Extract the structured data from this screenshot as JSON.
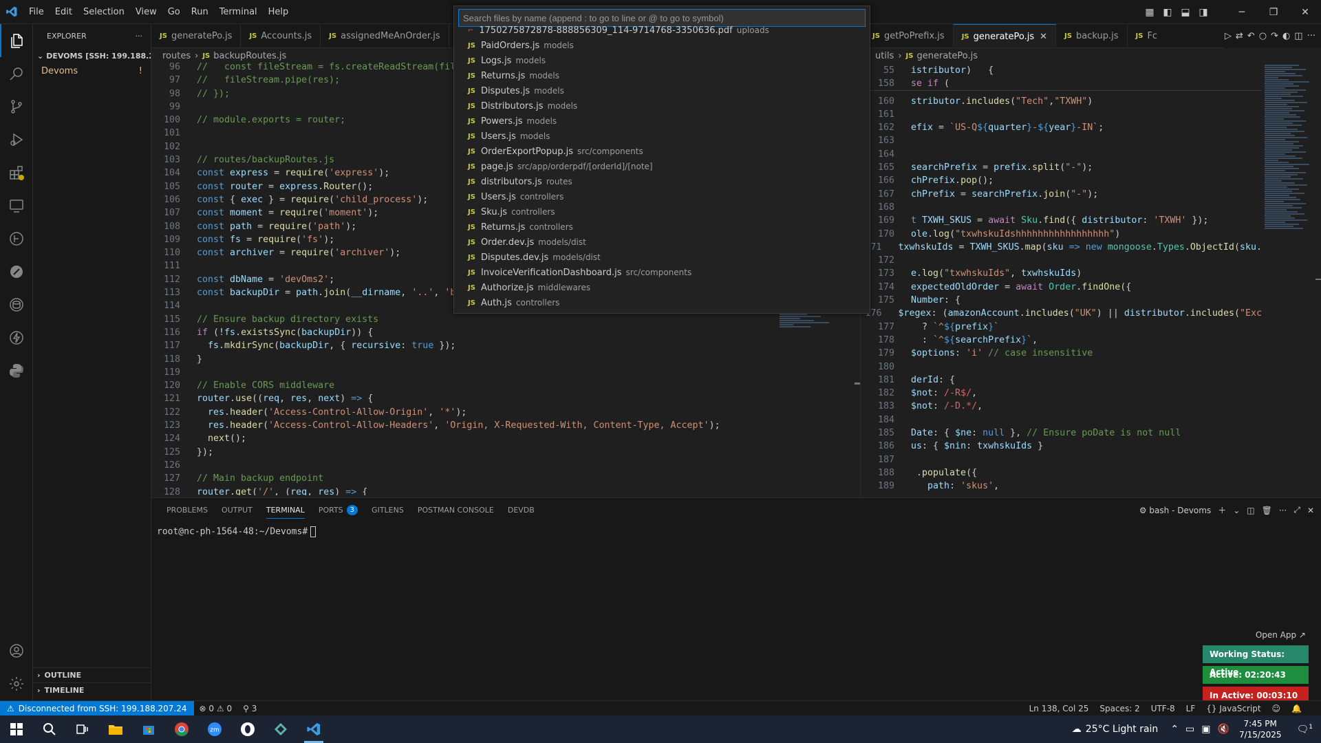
{
  "menu": [
    "File",
    "Edit",
    "Selection",
    "View",
    "Go",
    "Run",
    "Terminal",
    "Help"
  ],
  "sidebar": {
    "title": "EXPLORER",
    "folder": "DEVOMS [SSH: 199.188.20...",
    "item": "Devoms",
    "item_badge": "!",
    "outline": "OUTLINE",
    "timeline": "TIMELINE"
  },
  "editor1": {
    "tabs": [
      {
        "label": "generatePo.js",
        "active": false
      },
      {
        "label": "Accounts.js",
        "active": false
      },
      {
        "label": "assignedMeAnOrder.js",
        "active": false
      }
    ],
    "breadcrumb": {
      "folder": "routes",
      "file": "backupRoutes.js"
    },
    "line_numbers": [
      96,
      97,
      98,
      99,
      100,
      101,
      102,
      103,
      104,
      105,
      106,
      107,
      108,
      109,
      110,
      111,
      112,
      113,
      114,
      115,
      116,
      117,
      118,
      119,
      120,
      121,
      122,
      123,
      124,
      125,
      126,
      127,
      128
    ]
  },
  "editor2": {
    "tabs": [
      {
        "label": "getPoPrefix.js",
        "active": false
      },
      {
        "label": "generatePo.js",
        "active": true
      },
      {
        "label": "backup.js",
        "active": false
      },
      {
        "label": "Fc",
        "active": false
      }
    ],
    "breadcrumb": {
      "folder": "utils",
      "file": "generatePo.js"
    },
    "line_numbers": [
      55,
      158,
      160,
      161,
      162,
      163,
      164,
      165,
      166,
      167,
      168,
      169,
      170,
      171,
      172,
      173,
      174,
      175,
      176,
      177,
      178,
      179,
      180,
      181,
      182,
      183,
      184,
      185,
      186,
      187,
      188,
      189
    ]
  },
  "palette": {
    "placeholder": "Search files by name (append : to go to line or @ to go to symbol)",
    "items": [
      {
        "name": "1750275872878-888856309_114-9714768-3350636.pdf",
        "desc": "uploads",
        "type": "pdf"
      },
      {
        "name": "PaidOrders.js",
        "desc": "models",
        "type": "js"
      },
      {
        "name": "Logs.js",
        "desc": "models",
        "type": "js"
      },
      {
        "name": "Returns.js",
        "desc": "models",
        "type": "js"
      },
      {
        "name": "Disputes.js",
        "desc": "models",
        "type": "js"
      },
      {
        "name": "Distributors.js",
        "desc": "models",
        "type": "js"
      },
      {
        "name": "Powers.js",
        "desc": "models",
        "type": "js"
      },
      {
        "name": "Users.js",
        "desc": "models",
        "type": "js"
      },
      {
        "name": "OrderExportPopup.js",
        "desc": "src/components",
        "type": "js"
      },
      {
        "name": "page.js",
        "desc": "src/app/orderpdf/[orderId]/[note]",
        "type": "js"
      },
      {
        "name": "distributors.js",
        "desc": "routes",
        "type": "js"
      },
      {
        "name": "Users.js",
        "desc": "controllers",
        "type": "js"
      },
      {
        "name": "Sku.js",
        "desc": "controllers",
        "type": "js"
      },
      {
        "name": "Returns.js",
        "desc": "controllers",
        "type": "js"
      },
      {
        "name": "Order.dev.js",
        "desc": "models/dist",
        "type": "js"
      },
      {
        "name": "Disputes.dev.js",
        "desc": "models/dist",
        "type": "js"
      },
      {
        "name": "InvoiceVerificationDashboard.js",
        "desc": "src/components",
        "type": "js"
      },
      {
        "name": "Authorize.js",
        "desc": "middlewares",
        "type": "js"
      },
      {
        "name": "Auth.js",
        "desc": "controllers",
        "type": "js"
      }
    ]
  },
  "panel": {
    "tabs": [
      "PROBLEMS",
      "OUTPUT",
      "TERMINAL",
      "PORTS",
      "GITLENS",
      "POSTMAN CONSOLE",
      "DEVDB"
    ],
    "active_tab": "TERMINAL",
    "ports_count": "3",
    "shell": "bash - Devoms",
    "prompt": "root@nc-ph-1564-48:~/Devoms#"
  },
  "widget": {
    "open_app": "Open App ↗",
    "working_status": "Working Status: Active",
    "active_time": "Active: 02:20:43",
    "inactive_time": "In Active: 00:03:10",
    "colors": {
      "working": "#26876b",
      "active": "#1e8e3e",
      "inactive": "#c5221f"
    }
  },
  "statusbar": {
    "remote": "Disconnected from SSH: 199.188.207.24",
    "errors": "0",
    "warnings": "0",
    "ports": "3",
    "position": "Ln 138, Col 25",
    "spaces": "Spaces: 2",
    "encoding": "UTF-8",
    "eol": "LF",
    "language": "JavaScript"
  },
  "taskbar": {
    "weather": "25°C  Light rain",
    "time": "7:45 PM",
    "date": "7/15/2025",
    "notifications": "1"
  }
}
